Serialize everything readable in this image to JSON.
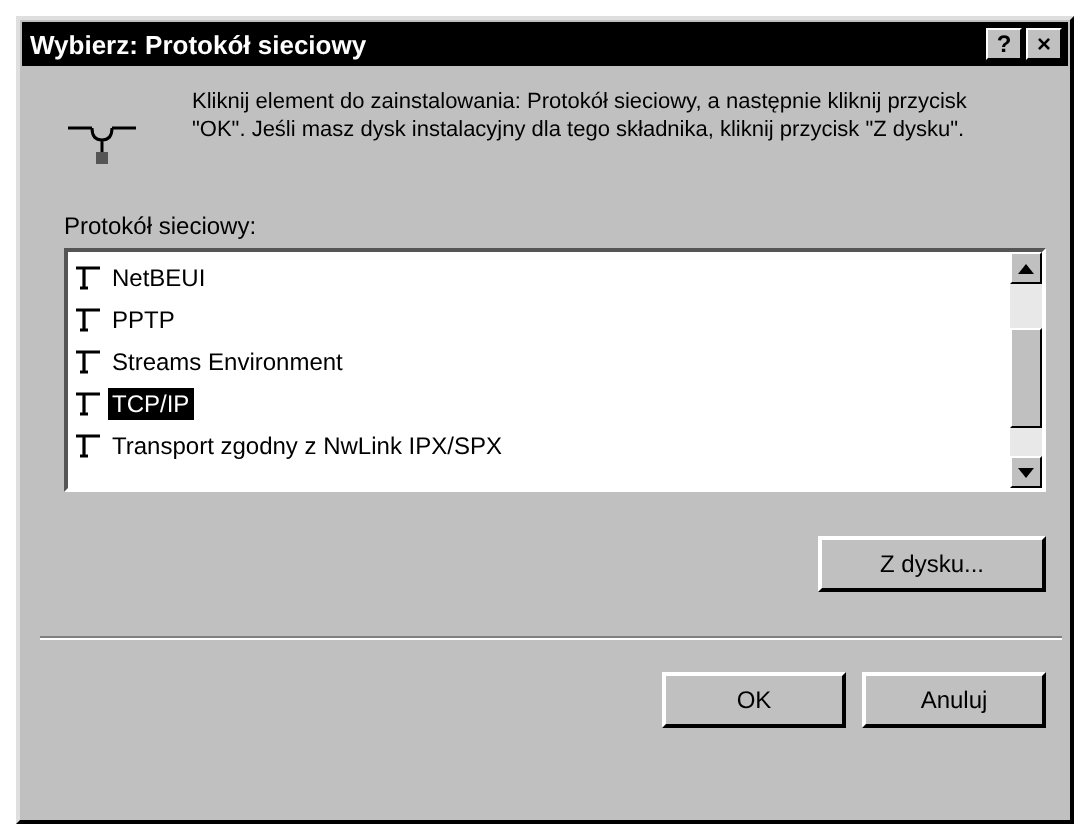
{
  "window": {
    "title": "Wybierz: Protokół sieciowy",
    "title_buttons": [
      "?",
      "×"
    ]
  },
  "instruction": "Kliknij element do zainstalowania: Protokół sieciowy, a następnie kliknij przycisk \"OK\".  Jeśli masz dysk instalacyjny dla tego składnika, kliknij przycisk \"Z dysku\".",
  "list": {
    "label": "Protokół sieciowy:",
    "items": [
      {
        "label": "NetBEUI",
        "selected": false
      },
      {
        "label": "PPTP",
        "selected": false
      },
      {
        "label": "Streams Environment",
        "selected": false
      },
      {
        "label": "TCP/IP",
        "selected": true
      },
      {
        "label": "Transport zgodny z NwLink IPX/SPX",
        "selected": false
      }
    ]
  },
  "buttons": [
    {
      "label": "Z dysku...",
      "kind": "side"
    },
    {
      "label": "OK",
      "kind": "footer"
    },
    {
      "label": "Anuluj",
      "kind": "footer"
    }
  ]
}
